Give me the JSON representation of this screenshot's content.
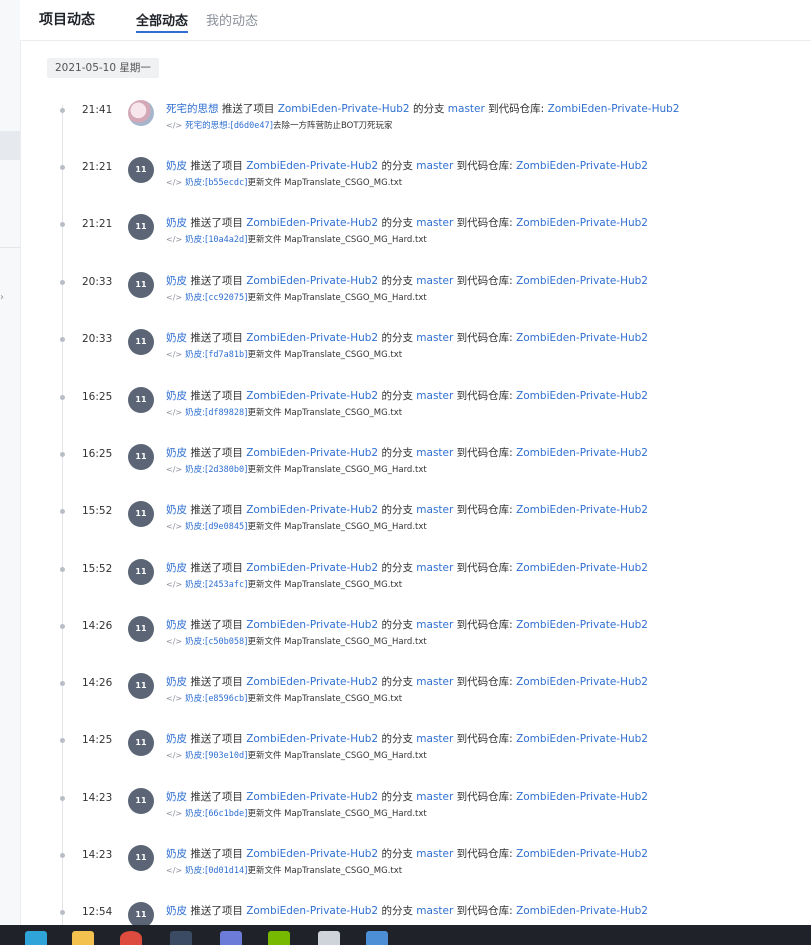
{
  "header": {
    "title": "项目动态",
    "tabs": [
      {
        "label": "全部动态",
        "active": true
      },
      {
        "label": "我的动态",
        "active": false
      }
    ]
  },
  "date_badge": "2021-05-10 星期一",
  "strings": {
    "pushed_to_project": "推送了项目",
    "branch_of": "的分支",
    "to_repo": "到代码仓库:",
    "update_file": "更新文件"
  },
  "project": "ZombiEden-Private-Hub2",
  "branch": "master",
  "events": [
    {
      "time": "21:41",
      "user": "死宅的思想",
      "avatar": "photo",
      "author": "死宅的思想",
      "hash": "d6d0e47",
      "message": "去除一方阵营防止BOT刀死玩家"
    },
    {
      "time": "21:21",
      "user": "奶皮",
      "avatar": "11",
      "author": "奶皮",
      "hash": "b55ecdc",
      "message": "更新文件 MapTranslate_CSGO_MG.txt"
    },
    {
      "time": "21:21",
      "user": "奶皮",
      "avatar": "11",
      "author": "奶皮",
      "hash": "10a4a2d",
      "message": "更新文件 MapTranslate_CSGO_MG_Hard.txt"
    },
    {
      "time": "20:33",
      "user": "奶皮",
      "avatar": "11",
      "author": "奶皮",
      "hash": "cc92075",
      "message": "更新文件 MapTranslate_CSGO_MG_Hard.txt"
    },
    {
      "time": "20:33",
      "user": "奶皮",
      "avatar": "11",
      "author": "奶皮",
      "hash": "fd7a81b",
      "message": "更新文件 MapTranslate_CSGO_MG.txt"
    },
    {
      "time": "16:25",
      "user": "奶皮",
      "avatar": "11",
      "author": "奶皮",
      "hash": "df89828",
      "message": "更新文件 MapTranslate_CSGO_MG.txt"
    },
    {
      "time": "16:25",
      "user": "奶皮",
      "avatar": "11",
      "author": "奶皮",
      "hash": "2d380b0",
      "message": "更新文件 MapTranslate_CSGO_MG_Hard.txt"
    },
    {
      "time": "15:52",
      "user": "奶皮",
      "avatar": "11",
      "author": "奶皮",
      "hash": "d9e0845",
      "message": "更新文件 MapTranslate_CSGO_MG_Hard.txt"
    },
    {
      "time": "15:52",
      "user": "奶皮",
      "avatar": "11",
      "author": "奶皮",
      "hash": "2453afc",
      "message": "更新文件 MapTranslate_CSGO_MG.txt"
    },
    {
      "time": "14:26",
      "user": "奶皮",
      "avatar": "11",
      "author": "奶皮",
      "hash": "c50b058",
      "message": "更新文件 MapTranslate_CSGO_MG_Hard.txt"
    },
    {
      "time": "14:26",
      "user": "奶皮",
      "avatar": "11",
      "author": "奶皮",
      "hash": "e8596cb",
      "message": "更新文件 MapTranslate_CSGO_MG.txt"
    },
    {
      "time": "14:25",
      "user": "奶皮",
      "avatar": "11",
      "author": "奶皮",
      "hash": "903e10d",
      "message": "更新文件 MapTranslate_CSGO_MG_Hard.txt"
    },
    {
      "time": "14:23",
      "user": "奶皮",
      "avatar": "11",
      "author": "奶皮",
      "hash": "66c1bde",
      "message": "更新文件 MapTranslate_CSGO_MG_Hard.txt"
    },
    {
      "time": "14:23",
      "user": "奶皮",
      "avatar": "11",
      "author": "奶皮",
      "hash": "0d01d14",
      "message": "更新文件 MapTranslate_CSGO_MG.txt"
    },
    {
      "time": "12:54",
      "user": "奶皮",
      "avatar": "11",
      "author": "奶皮",
      "hash": "",
      "message": ""
    }
  ],
  "taskbar": {
    "icons": [
      {
        "name": "edge-icon",
        "color": "#2fa4d8"
      },
      {
        "name": "file-explorer-icon",
        "color": "#f2c14e"
      },
      {
        "name": "chrome-icon",
        "color": "#dd4b3e"
      },
      {
        "name": "steam-icon",
        "color": "#3a4b63"
      },
      {
        "name": "discord-icon",
        "color": "#6c7ad8"
      },
      {
        "name": "nvidia-icon",
        "color": "#76b900"
      },
      {
        "name": "obs-icon",
        "color": "#cfd3da"
      },
      {
        "name": "app-icon",
        "color": "#4d8fd6"
      }
    ]
  }
}
